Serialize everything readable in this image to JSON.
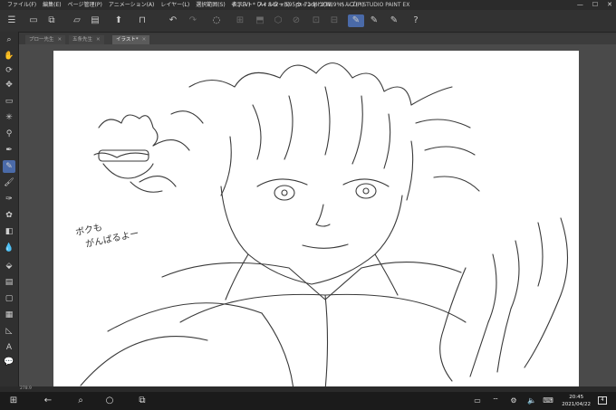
{
  "titlebar": {
    "menus": [
      "ファイル(F)",
      "編集(E)",
      "ページ管理(P)",
      "アニメーション(A)",
      "レイヤー(L)",
      "選択範囲(S)",
      "表示(V)",
      "フィルター(I)",
      "ウィンドウ(W)",
      "ヘルプ(H)"
    ],
    "title": "イラスト* (A4 842 x 595px 72dpi 278.9%) - CLIP STUDIO PAINT EX",
    "minimize": "—",
    "maximize": "☐",
    "close": "✕"
  },
  "tabs": [
    {
      "label": "プロ一先生",
      "close": "✕"
    },
    {
      "label": "五条先生",
      "close": "✕"
    },
    {
      "label": "イラスト*",
      "close": "✕"
    }
  ],
  "canvas_text": {
    "line1": "ボクも",
    "line2": "がんばるよー"
  },
  "status": {
    "zoom": "278.9"
  },
  "taskbar": {
    "time": "20:45",
    "date": "2021/04/22",
    "notification_count": "4"
  },
  "colors": {
    "accent": "#4a6aa8",
    "drawing_color": "#5a6ea8"
  }
}
